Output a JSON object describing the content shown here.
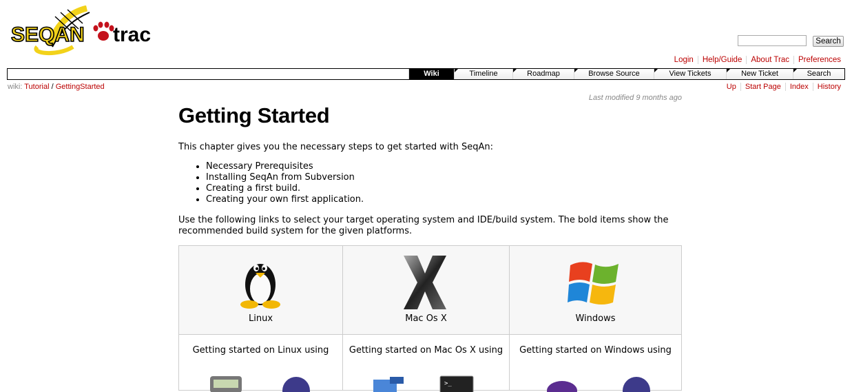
{
  "logo": {
    "seqan": "SEQAN",
    "trac": "trac"
  },
  "search": {
    "placeholder": "",
    "button": "Search"
  },
  "metanav": [
    "Login",
    "Help/Guide",
    "About Trac",
    "Preferences"
  ],
  "mainnav": [
    "Wiki",
    "Timeline",
    "Roadmap",
    "Browse Source",
    "View Tickets",
    "New Ticket",
    "Search"
  ],
  "mainnav_active": "Wiki",
  "breadcrumb": {
    "label": "wiki:",
    "parent": "Tutorial",
    "sep": "/",
    "current": "GettingStarted"
  },
  "ctxnav": [
    "Up",
    "Start Page",
    "Index",
    "History"
  ],
  "last_modified": {
    "prefix": "Last modified",
    "age": "9 months ago"
  },
  "page": {
    "title": "Getting Started",
    "intro": "This chapter gives you the necessary steps to get started with SeqAn:",
    "steps": [
      "Necessary Prerequisites",
      "Installing SeqAn from Subversion",
      "Creating a first build.",
      "Creating your own first application."
    ],
    "paragraph": "Use the following links to select your target operating system and IDE/build system. The bold items show the recommended build system for the given platforms."
  },
  "os_table": {
    "os": [
      "Linux",
      "Mac Os X",
      "Windows"
    ],
    "using": [
      "Getting started on Linux using",
      "Getting started on Mac Os X using",
      "Getting started on Windows using"
    ]
  },
  "colors": {
    "link": "#bb0000",
    "seqan_yellow": "#f2d21a",
    "trac_red": "#b00000"
  }
}
